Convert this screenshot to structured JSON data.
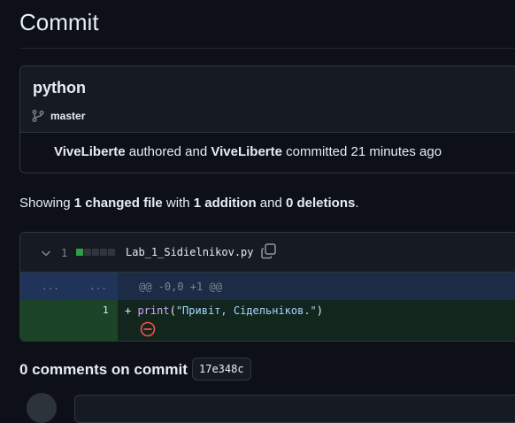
{
  "page": {
    "title": "Commit"
  },
  "commit": {
    "message": "python",
    "branch": "master",
    "author": "ViveLiberte",
    "authored_text": "authored and",
    "committer": "ViveLiberte",
    "committed_text": "committed 21 minutes ago"
  },
  "summary": {
    "prefix": "Showing",
    "changed": "1 changed file",
    "with": "with",
    "additions": "1 addition",
    "and": "and",
    "deletions": "0 deletions",
    "suffix": "."
  },
  "diff": {
    "count": "1",
    "file_name": "Lab_1_Sidielnikov.py",
    "stat_colors": [
      "#2ea043",
      "#30363d",
      "#30363d",
      "#30363d",
      "#30363d"
    ],
    "hunk": {
      "old_gutter": "...",
      "new_gutter": "...",
      "header": "@@ -0,0 +1 @@"
    },
    "lines": [
      {
        "new_line": "1",
        "sign": "+",
        "fn": "print",
        "open": "(",
        "str": "\"Привіт, Сідельніков.\"",
        "close": ")"
      }
    ],
    "no_newline_icon": "no-entry-icon"
  },
  "comments": {
    "title": "0 comments on commit",
    "sha": "17e348c"
  },
  "colors": {
    "background": "#0d1117",
    "border": "#30363d",
    "addition_bg": "#12261e",
    "addition_gutter": "#1c4428",
    "hunk_gutter": "#1f3458",
    "no_newline_red": "#f85149"
  }
}
